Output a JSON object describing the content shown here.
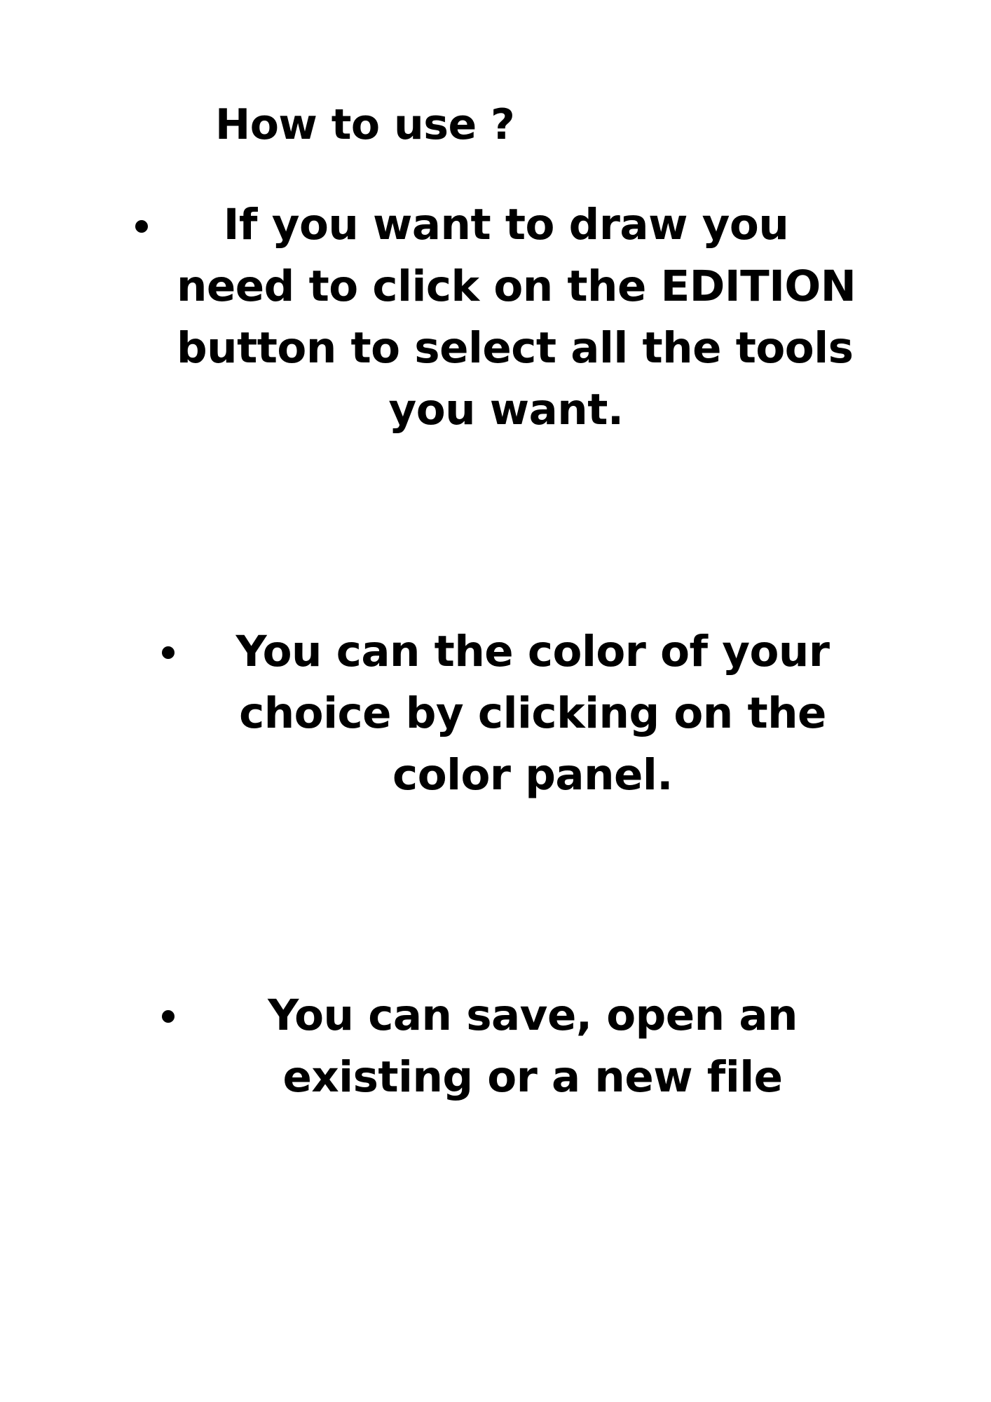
{
  "title": "How to use ?",
  "instructions": [
    {
      "lines": [
        "If you want to draw you",
        "need to click on the EDITION",
        "button to select all the tools",
        "you want."
      ]
    },
    {
      "lines": [
        "You can the color of your",
        "choice by clicking on the",
        "color panel."
      ]
    },
    {
      "lines": [
        "You can save, open an",
        "existing or a new file"
      ]
    }
  ]
}
